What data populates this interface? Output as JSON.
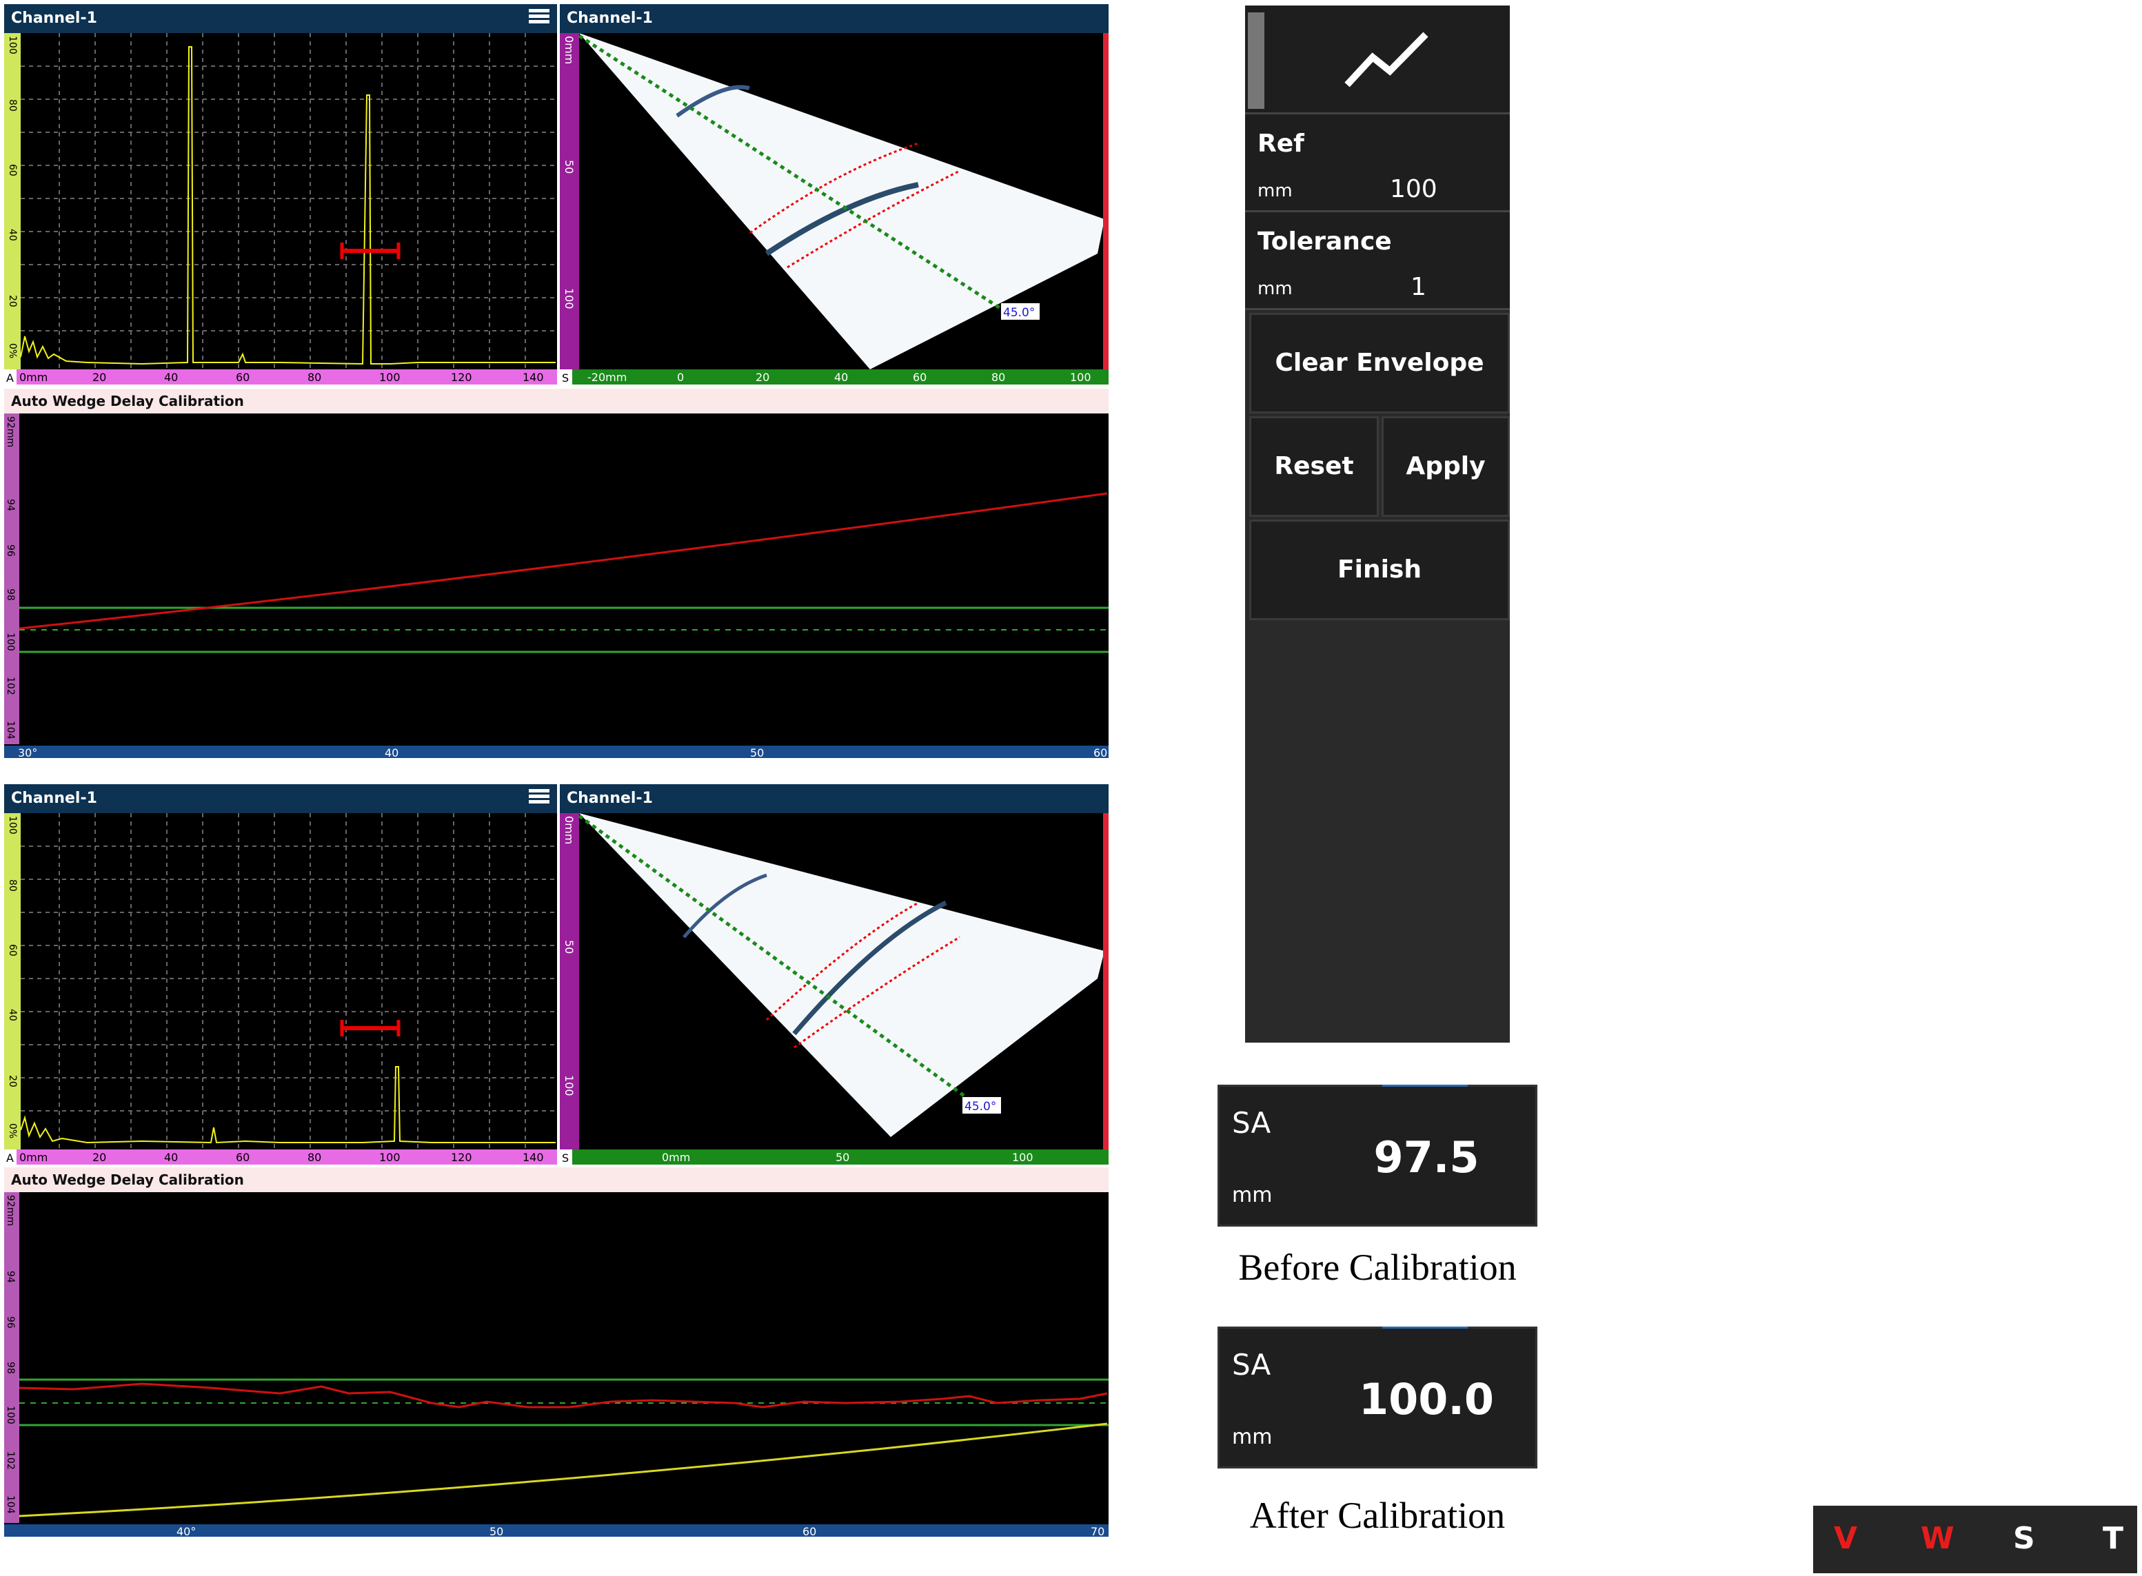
{
  "top": {
    "ascan": {
      "title": "Channel-1",
      "view_letter": "A",
      "amp_ticks": [
        "100",
        "80",
        "60",
        "40",
        "20",
        "0%"
      ],
      "x_ticks": [
        "0mm",
        "20",
        "40",
        "60",
        "80",
        "100",
        "120",
        "140"
      ]
    },
    "sscan": {
      "title": "Channel-1",
      "view_letter": "S",
      "angle_label": "45.0°",
      "depth_ticks": [
        "0mm",
        "50",
        "100"
      ],
      "x_ticks": [
        "-20mm",
        "0",
        "20",
        "40",
        "60",
        "80",
        "100"
      ]
    },
    "cal": {
      "title": "Auto Wedge Delay Calibration",
      "y_ticks": [
        "92mm",
        "94",
        "96",
        "98",
        "100",
        "102",
        "104"
      ],
      "x_ticks": [
        "30°",
        "40",
        "50",
        "60"
      ]
    }
  },
  "bottom": {
    "ascan": {
      "title": "Channel-1",
      "view_letter": "A",
      "amp_ticks": [
        "100",
        "80",
        "60",
        "40",
        "20",
        "0%"
      ],
      "x_ticks": [
        "0mm",
        "20",
        "40",
        "60",
        "80",
        "100",
        "120",
        "140"
      ]
    },
    "sscan": {
      "title": "Channel-1",
      "view_letter": "S",
      "angle_label": "45.0°",
      "depth_ticks": [
        "0mm",
        "50",
        "100"
      ],
      "x_ticks": [
        "0mm",
        "50",
        "100"
      ]
    },
    "cal": {
      "title": "Auto Wedge Delay Calibration",
      "y_ticks": [
        "92mm",
        "94",
        "96",
        "98",
        "100",
        "102",
        "104"
      ],
      "x_ticks": [
        "40°",
        "50",
        "60",
        "70"
      ]
    }
  },
  "right_panel": {
    "icon": "trend-line-icon",
    "ref": {
      "label": "Ref",
      "unit": "mm",
      "value": "100"
    },
    "tolerance": {
      "label": "Tolerance",
      "unit": "mm",
      "value": "1"
    },
    "clear_envelope": "Clear Envelope",
    "reset": "Reset",
    "apply": "Apply",
    "finish": "Finish"
  },
  "readout_before": {
    "label": "SA",
    "unit": "mm",
    "value": "97.5",
    "caption": "Before Calibration"
  },
  "readout_after": {
    "label": "SA",
    "unit": "mm",
    "value": "100.0",
    "caption": "After Calibration"
  },
  "view_buttons": [
    "V",
    "W",
    "S",
    "T"
  ],
  "colors": {
    "title_bar": "#0d3252",
    "trace_yellow": "#f2f21a",
    "red_curve": "#d01010",
    "tolerance_green": "#2fa82f",
    "view_red": "#e81c1c"
  }
}
